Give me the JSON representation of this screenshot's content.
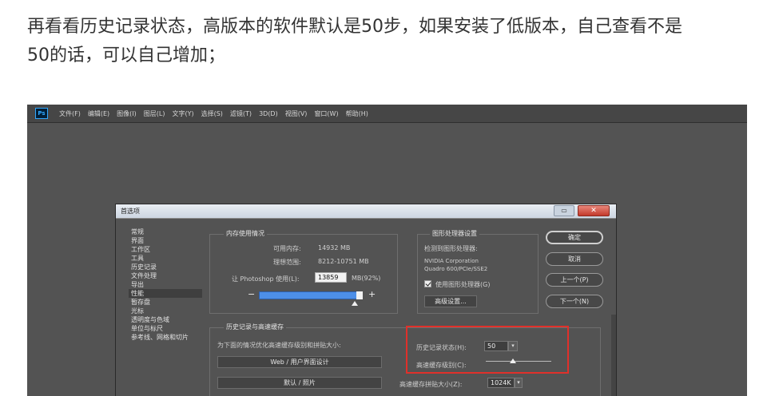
{
  "article": {
    "line1": "再看看历史记录状态，高版本的软件默认是50步，如果安装了低版本，自己查看不是",
    "line2": "50的话，可以自己增加；"
  },
  "menubar": {
    "logo": "Ps",
    "items": [
      "文件(F)",
      "编辑(E)",
      "图像(I)",
      "图层(L)",
      "文字(Y)",
      "选择(S)",
      "滤镜(T)",
      "3D(D)",
      "视图(V)",
      "窗口(W)",
      "帮助(H)"
    ]
  },
  "dialog": {
    "title": "首选项",
    "close_glyph": "✕",
    "nav_items": [
      "常规",
      "界面",
      "工作区",
      "工具",
      "历史记录",
      "文件处理",
      "导出",
      "性能",
      "暂存盘",
      "光标",
      "透明度与色域",
      "单位与标尺",
      "参考线、网格和切片"
    ],
    "selected_nav": "性能",
    "memory": {
      "group_title": "内存使用情况",
      "available_label": "可用内存:",
      "available_value": "14932 MB",
      "ideal_label": "理想范围:",
      "ideal_value": "8212-10751 MB",
      "let_label": "让 Photoshop 使用(L):",
      "let_value": "13859",
      "let_unit": "MB(92%)",
      "minus": "−",
      "plus": "+",
      "slider_fraction": 0.92
    },
    "gpu": {
      "group_title": "图形处理器设置",
      "detected_label": "检测到图形处理器:",
      "gpu_line1": "NVIDIA Corporation",
      "gpu_line2": "Quadro 600/PCIe/SSE2",
      "use_gpu_label": "使用图形处理器(G)",
      "use_gpu_checked": true,
      "advanced_button": "高级设置..."
    },
    "history_cache": {
      "group_title": "历史记录与高速缓存",
      "hint": "为下面的情况优化高速缓存级别和拼贴大小:",
      "web_ui_button": "Web / 用户界面设计",
      "default_button": "默认 / 照片",
      "history_states_label": "历史记录状态(H):",
      "history_states_value": "50",
      "cache_levels_label": "高速缓存级别(C):",
      "tile_size_label": "高速缓存拼贴大小(Z):",
      "tile_size_value": "1024K"
    },
    "buttons": {
      "ok": "确定",
      "cancel": "取消",
      "prev": "上一个(P)",
      "next": "下一个(N)"
    }
  },
  "colors": {
    "highlight": "#e0302a",
    "slider": "#4d8fe8"
  }
}
